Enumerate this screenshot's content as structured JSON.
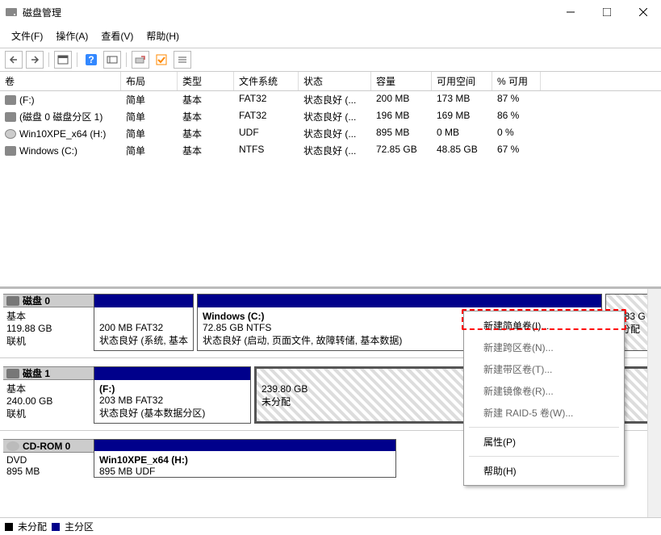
{
  "window": {
    "title": "磁盘管理"
  },
  "menu": {
    "file": "文件(F)",
    "action": "操作(A)",
    "view": "查看(V)",
    "help": "帮助(H)"
  },
  "columns": {
    "c0": "卷",
    "c1": "布局",
    "c2": "类型",
    "c3": "文件系统",
    "c4": "状态",
    "c5": "容量",
    "c6": "可用空间",
    "c7": "% 可用"
  },
  "rows": [
    {
      "name": "(F:)",
      "layout": "简单",
      "type": "基本",
      "fs": "FAT32",
      "status": "状态良好 (...",
      "cap": "200 MB",
      "free": "173 MB",
      "pct": "87 %"
    },
    {
      "name": "(磁盘 0 磁盘分区 1)",
      "layout": "简单",
      "type": "基本",
      "fs": "FAT32",
      "status": "状态良好 (...",
      "cap": "196 MB",
      "free": "169 MB",
      "pct": "86 %"
    },
    {
      "name": "Win10XPE_x64 (H:)",
      "layout": "简单",
      "type": "基本",
      "fs": "UDF",
      "status": "状态良好 (...",
      "cap": "895 MB",
      "free": "0 MB",
      "pct": "0 %"
    },
    {
      "name": "Windows (C:)",
      "layout": "简单",
      "type": "基本",
      "fs": "NTFS",
      "status": "状态良好 (...",
      "cap": "72.85 GB",
      "free": "48.85 GB",
      "pct": "67 %"
    }
  ],
  "disk0": {
    "label": "磁盘 0",
    "type": "基本",
    "size": "119.88 GB",
    "state": "联机",
    "p0": {
      "size": "200 MB FAT32",
      "status": "状态良好 (系统, 基本"
    },
    "p1": {
      "title": "Windows  (C:)",
      "size": "72.85 GB NTFS",
      "status": "状态良好 (启动, 页面文件, 故障转储, 基本数据)"
    },
    "p2": {
      "size": "46.83 G",
      "status": "未分配"
    }
  },
  "disk1": {
    "label": "磁盘 1",
    "type": "基本",
    "size": "240.00 GB",
    "state": "联机",
    "p0": {
      "title": "(F:)",
      "size": "203 MB FAT32",
      "status": "状态良好 (基本数据分区)"
    },
    "p1": {
      "size": "239.80 GB",
      "status": "未分配"
    }
  },
  "cd0": {
    "label": "CD-ROM 0",
    "type": "DVD",
    "size": "895 MB",
    "p0": {
      "title": "Win10XPE_x64  (H:)",
      "size": "895 MB UDF"
    }
  },
  "legend": {
    "unalloc": "未分配",
    "primary": "主分区"
  },
  "ctx": {
    "simple": "新建简单卷(I)...",
    "span": "新建跨区卷(N)...",
    "stripe": "新建带区卷(T)...",
    "mirror": "新建镜像卷(R)...",
    "raid5": "新建 RAID-5 卷(W)...",
    "prop": "属性(P)",
    "help": "帮助(H)"
  }
}
